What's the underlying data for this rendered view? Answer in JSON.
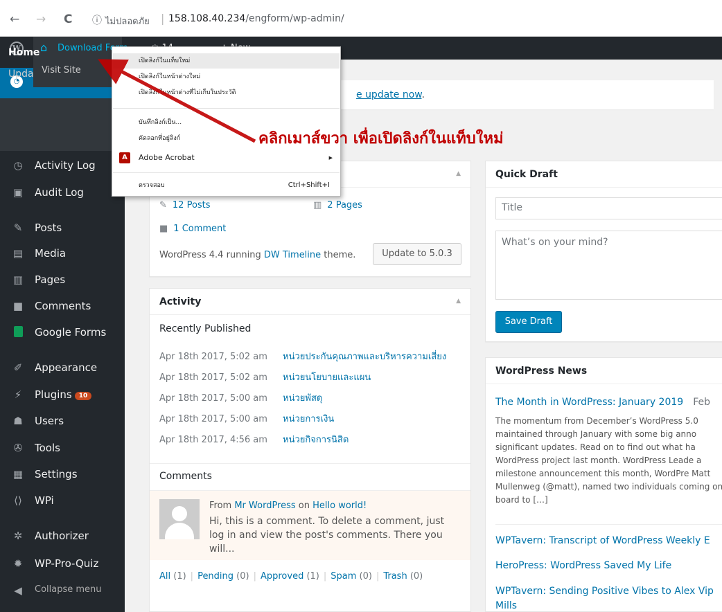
{
  "browser": {
    "back": "←",
    "forward": "→",
    "reload": "C",
    "info_icon": "ⓘ",
    "insecure": "ไม่ปลอดภัย",
    "url_host": "158.108.40.234",
    "url_path": "/engform/wp-admin/"
  },
  "adminbar": {
    "site_name": "Download Form",
    "comments_count": "14",
    "new_label": "New",
    "visit_site": "Visit Site"
  },
  "sidebar": {
    "home": "Home",
    "updates": "Updates",
    "updates_count": "14",
    "items": [
      {
        "label": "Activity Log",
        "icon": "◷"
      },
      {
        "label": "Audit Log",
        "icon": "▣"
      },
      {
        "label": "Posts",
        "icon": "✎"
      },
      {
        "label": "Media",
        "icon": "▤"
      },
      {
        "label": "Pages",
        "icon": "▥"
      },
      {
        "label": "Comments",
        "icon": "■"
      },
      {
        "label": "Google Forms",
        "icon": ""
      },
      {
        "label": "Appearance",
        "icon": "✐"
      },
      {
        "label": "Plugins",
        "icon": "⚡"
      },
      {
        "label": "Users",
        "icon": "☗"
      },
      {
        "label": "Tools",
        "icon": "✇"
      },
      {
        "label": "Settings",
        "icon": "▦"
      },
      {
        "label": "WPi",
        "icon": "⟨⟩"
      },
      {
        "label": "Authorizer",
        "icon": "✲"
      },
      {
        "label": "WP-Pro-Quiz",
        "icon": "✹"
      },
      {
        "label": "Collapse menu",
        "icon": "◀"
      }
    ],
    "plugins_count": "10"
  },
  "notice": {
    "link": "e update now",
    "tail": "."
  },
  "glance": {
    "posts": "12 Posts",
    "pages": "2 Pages",
    "comments": "1 Comment",
    "version_prefix": "WordPress 4.4 running ",
    "theme": "DW Timeline",
    "version_suffix": " theme.",
    "update_button": "Update to 5.0.3"
  },
  "activity": {
    "title": "Activity",
    "recently_published": "Recently Published",
    "rows": [
      {
        "date": "Apr 18th 2017, 5:02 am",
        "title": "หน่วยประกันคุณภาพและบริหารความเสี่ยง"
      },
      {
        "date": "Apr 18th 2017, 5:02 am",
        "title": "หน่วยนโยบายและแผน"
      },
      {
        "date": "Apr 18th 2017, 5:00 am",
        "title": "หน่วยพัสดุ"
      },
      {
        "date": "Apr 18th 2017, 5:00 am",
        "title": "หน่วยการเงิน"
      },
      {
        "date": "Apr 18th 2017, 4:56 am",
        "title": "หน่วยกิจการนิสิต"
      }
    ],
    "comments_heading": "Comments",
    "comment": {
      "from": "From ",
      "author": "Mr WordPress",
      "on": " on ",
      "post": "Hello world!",
      "text": "Hi, this is a comment. To delete a comment, just log in and view the post's comments. There you will..."
    },
    "filters": [
      {
        "label": "All",
        "count": " (1)"
      },
      {
        "label": "Pending",
        "count": " (0)"
      },
      {
        "label": "Approved",
        "count": " (1)"
      },
      {
        "label": "Spam",
        "count": " (0)"
      },
      {
        "label": "Trash",
        "count": " (0)"
      }
    ]
  },
  "draft": {
    "title": "Quick Draft",
    "title_placeholder": "Title",
    "content_placeholder": "What’s on your mind?",
    "save": "Save Draft"
  },
  "news": {
    "title": "WordPress News",
    "first_title": "The Month in WordPress: January 2019",
    "first_date": "Feb",
    "excerpt": "The momentum from December’s WordPress 5.0 maintained through January with some big anno significant updates. Read on to find out what ha WordPress project last month. WordPress Leade a milestone announcement this month, WordPre Matt Mullenweg (@matt), named two individuals coming on board to […]",
    "items": [
      "WPTavern: Transcript of WordPress Weekly E",
      "HeroPress: WordPress Saved My Life",
      "WPTavern: Sending Positive Vibes to Alex Vip",
      "Mills"
    ]
  },
  "context_menu": {
    "items": [
      "เปิดลิงก์ในแท็บใหม่",
      "เปิดลิงก์ในหน้าต่างใหม่",
      "เปิดลิงก์ในหน้าต่างที่ไม่เก็บในประวัติ",
      "บันทึกลิงก์เป็น...",
      "คัดลอกที่อยู่ลิงก์",
      "Adobe Acrobat",
      "ตรวจสอบ"
    ],
    "inspect_shortcut": "Ctrl+Shift+I"
  },
  "annotation": {
    "text": "คลิกเมาส์ขวา เพื่อเปิดลิงก์ในแท็บใหม่",
    "color": "#c00000"
  }
}
